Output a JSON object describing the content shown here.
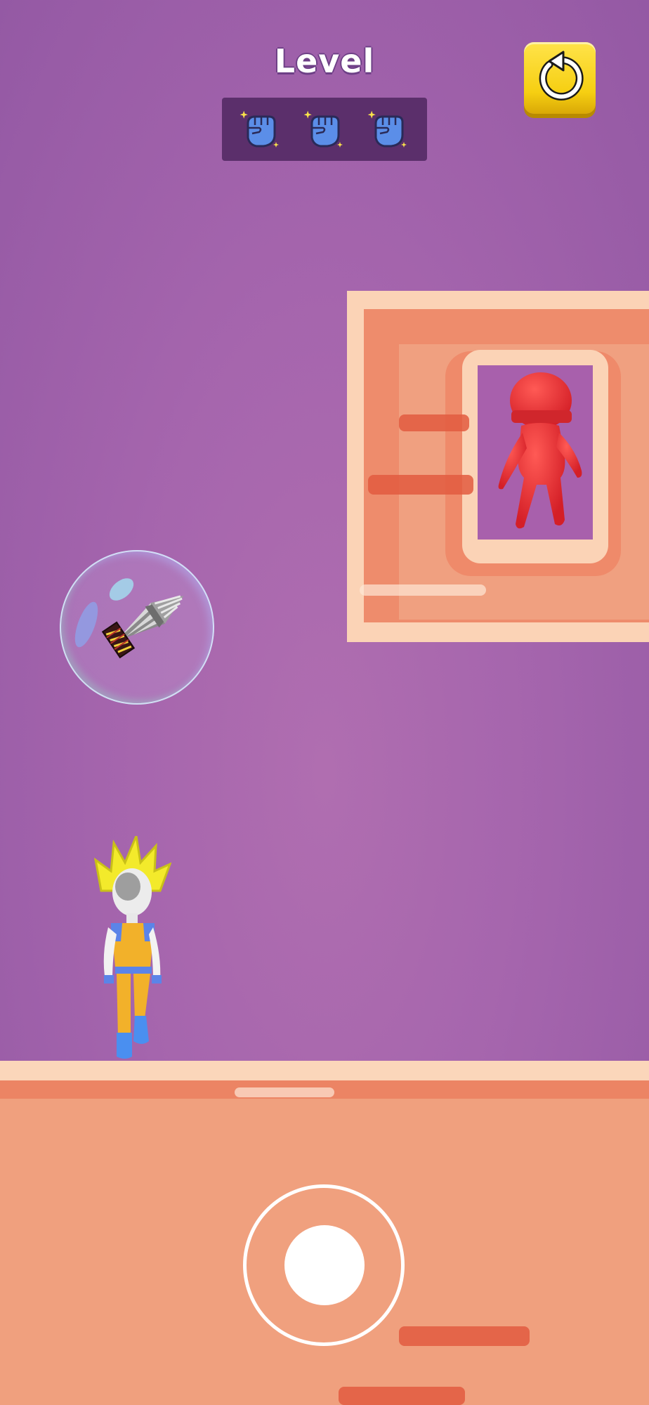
{
  "hud": {
    "level_label": "Level",
    "collectibles": [
      {
        "icon": "fist-icon"
      },
      {
        "icon": "fist-icon"
      },
      {
        "icon": "fist-icon"
      }
    ],
    "restart_icon": "restart-arrow-icon"
  },
  "scene": {
    "enemy": {
      "icon": "red-stickman-enemy"
    },
    "powerup": {
      "icon": "drill-powerup-icon"
    },
    "player": {
      "icon": "yellow-hair-hero"
    }
  },
  "controls": {
    "joystick": {
      "icon": "virtual-joystick"
    }
  },
  "colors": {
    "background": "#a565ad",
    "panel": "#5b2f6b",
    "restart_button": "#f6cf12",
    "wall": "#f0a080",
    "enemy": "#e8363a",
    "floor": "#f0a07e"
  }
}
